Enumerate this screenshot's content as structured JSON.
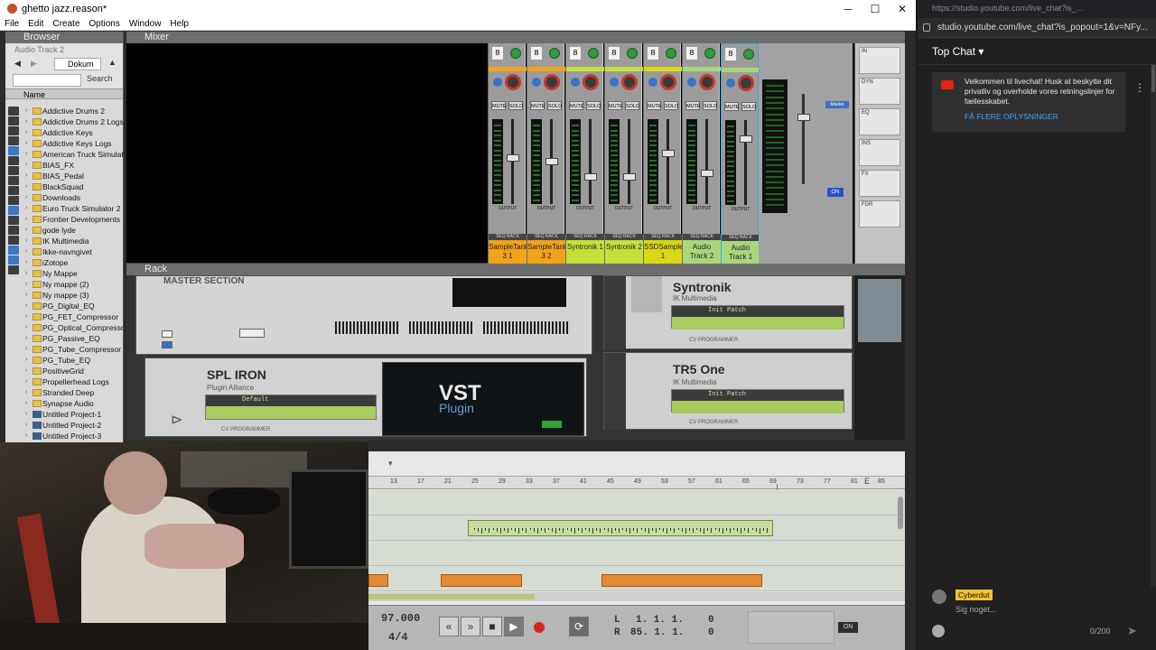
{
  "window": {
    "title": "ghetto jazz.reason*",
    "minimize": "─",
    "maximize": "☐",
    "close": "✕"
  },
  "menu": [
    "File",
    "Edit",
    "Create",
    "Options",
    "Window",
    "Help"
  ],
  "browser": {
    "header": "Browser",
    "subheader": "Audio Track 2",
    "location": "Dokum",
    "search_button": "Search",
    "column_header": "Name",
    "items": [
      {
        "label": "Addictive Drums 2",
        "kind": "folder"
      },
      {
        "label": "Addictive Drums 2 Logs",
        "kind": "folder"
      },
      {
        "label": "Addictive Keys",
        "kind": "folder"
      },
      {
        "label": "Addictive Keys Logs",
        "kind": "folder"
      },
      {
        "label": "American Truck Simulator",
        "kind": "folder"
      },
      {
        "label": "BIAS_FX",
        "kind": "folder"
      },
      {
        "label": "BIAS_Pedal",
        "kind": "folder"
      },
      {
        "label": "BlackSquad",
        "kind": "folder"
      },
      {
        "label": "Downloads",
        "kind": "folder"
      },
      {
        "label": "Euro Truck Simulator 2",
        "kind": "folder"
      },
      {
        "label": "Frontier Developments",
        "kind": "folder"
      },
      {
        "label": "gode lyde",
        "kind": "folder"
      },
      {
        "label": "IK Multimedia",
        "kind": "folder"
      },
      {
        "label": "Ikke-navngivet",
        "kind": "folder"
      },
      {
        "label": "iZotope",
        "kind": "folder"
      },
      {
        "label": "Ny Mappe",
        "kind": "folder"
      },
      {
        "label": "Ny mappe (2)",
        "kind": "folder"
      },
      {
        "label": "Ny mappe (3)",
        "kind": "folder"
      },
      {
        "label": "PG_Digital_EQ",
        "kind": "folder"
      },
      {
        "label": "PG_FET_Compressor",
        "kind": "folder"
      },
      {
        "label": "PG_Optical_Compressor",
        "kind": "folder"
      },
      {
        "label": "PG_Passive_EQ",
        "kind": "folder"
      },
      {
        "label": "PG_Tube_Compressor",
        "kind": "folder"
      },
      {
        "label": "PG_Tube_EQ",
        "kind": "folder"
      },
      {
        "label": "PositiveGrid",
        "kind": "folder"
      },
      {
        "label": "Propellerhead Logs",
        "kind": "folder"
      },
      {
        "label": "Stranded Deep",
        "kind": "folder"
      },
      {
        "label": "Synapse Audio",
        "kind": "folder"
      },
      {
        "label": "Untitled Project-1",
        "kind": "project"
      },
      {
        "label": "Untitled Project-2",
        "kind": "project"
      },
      {
        "label": "Untitled Project-3",
        "kind": "project"
      }
    ]
  },
  "mixer": {
    "header": "Mixer",
    "channels": [
      {
        "num": "8",
        "name": "SampleTank 3 1",
        "color": "#f2a21b",
        "fader": 0.55
      },
      {
        "num": "8",
        "name": "SampleTank 3 2",
        "color": "#f2a21b",
        "fader": 0.5
      },
      {
        "num": "8",
        "name": "Syntronik 1",
        "color": "#c5e03a",
        "fader": 0.3
      },
      {
        "num": "8",
        "name": "Syntronik 2",
        "color": "#c5e03a",
        "fader": 0.3
      },
      {
        "num": "8",
        "name": "SSDSampler5 1",
        "color": "#d8d814",
        "fader": 0.6
      },
      {
        "num": "8",
        "name": "Audio Track 2",
        "color": "#a9d77c",
        "fader": 0.35
      },
      {
        "num": "8",
        "name": "Audio Track 1",
        "color": "#a9d77c",
        "fader": 0.8
      }
    ],
    "mute": "MUTE",
    "solo": "SOLO",
    "output": "OUTPUT",
    "seq": "SEQ",
    "rack": "RACK",
    "master_tag": "Master",
    "master_on": "ON",
    "right_labels": [
      "IN",
      "DYN",
      "EQ",
      "INS",
      "FX",
      "FDR"
    ]
  },
  "rack": {
    "header": "Rack",
    "master_section": "MASTER SECTION",
    "devices": [
      {
        "title": "Syntronik",
        "maker": "IK Multimedia",
        "patch": "Init Patch"
      },
      {
        "title": "TR5 One",
        "maker": "IK Multimedia",
        "patch": "Init Patch"
      },
      {
        "title": "SPL IRON",
        "maker": "Plugin Alliance",
        "patch": "Default"
      }
    ],
    "vst_big": "VST",
    "vst_small": "Plugin",
    "cv_programmer": "CV PROGRAMMER"
  },
  "sequencer": {
    "bars": [
      "13",
      "17",
      "21",
      "25",
      "29",
      "33",
      "37",
      "41",
      "45",
      "49",
      "53",
      "57",
      "61",
      "65",
      "69",
      "73",
      "77",
      "81",
      "85"
    ]
  },
  "transport": {
    "tempo": "97.000",
    "signature": "4/4",
    "loop_left": "1. 1. 1.",
    "loop_right": "85. 1. 1.",
    "left_label": "L",
    "right_label": "R",
    "left_ticks": "0",
    "right_ticks": "0",
    "on_button": "ON"
  },
  "chat": {
    "title_url": "https://studio.youtube.com/live_chat?is_...",
    "address": "studio.youtube.com/live_chat?is_popout=1&v=NFy...",
    "header": "Top Chat",
    "notice": "Velkommen til livechat! Husk at beskytte dit privatliv og overholde vores retningslinjer for fællesskabet.",
    "notice_link": "FÅ FLERE OPLYSNINGER",
    "user": "Cyberdut",
    "input_placeholder": "Sig noget...",
    "counter": "0/200"
  }
}
